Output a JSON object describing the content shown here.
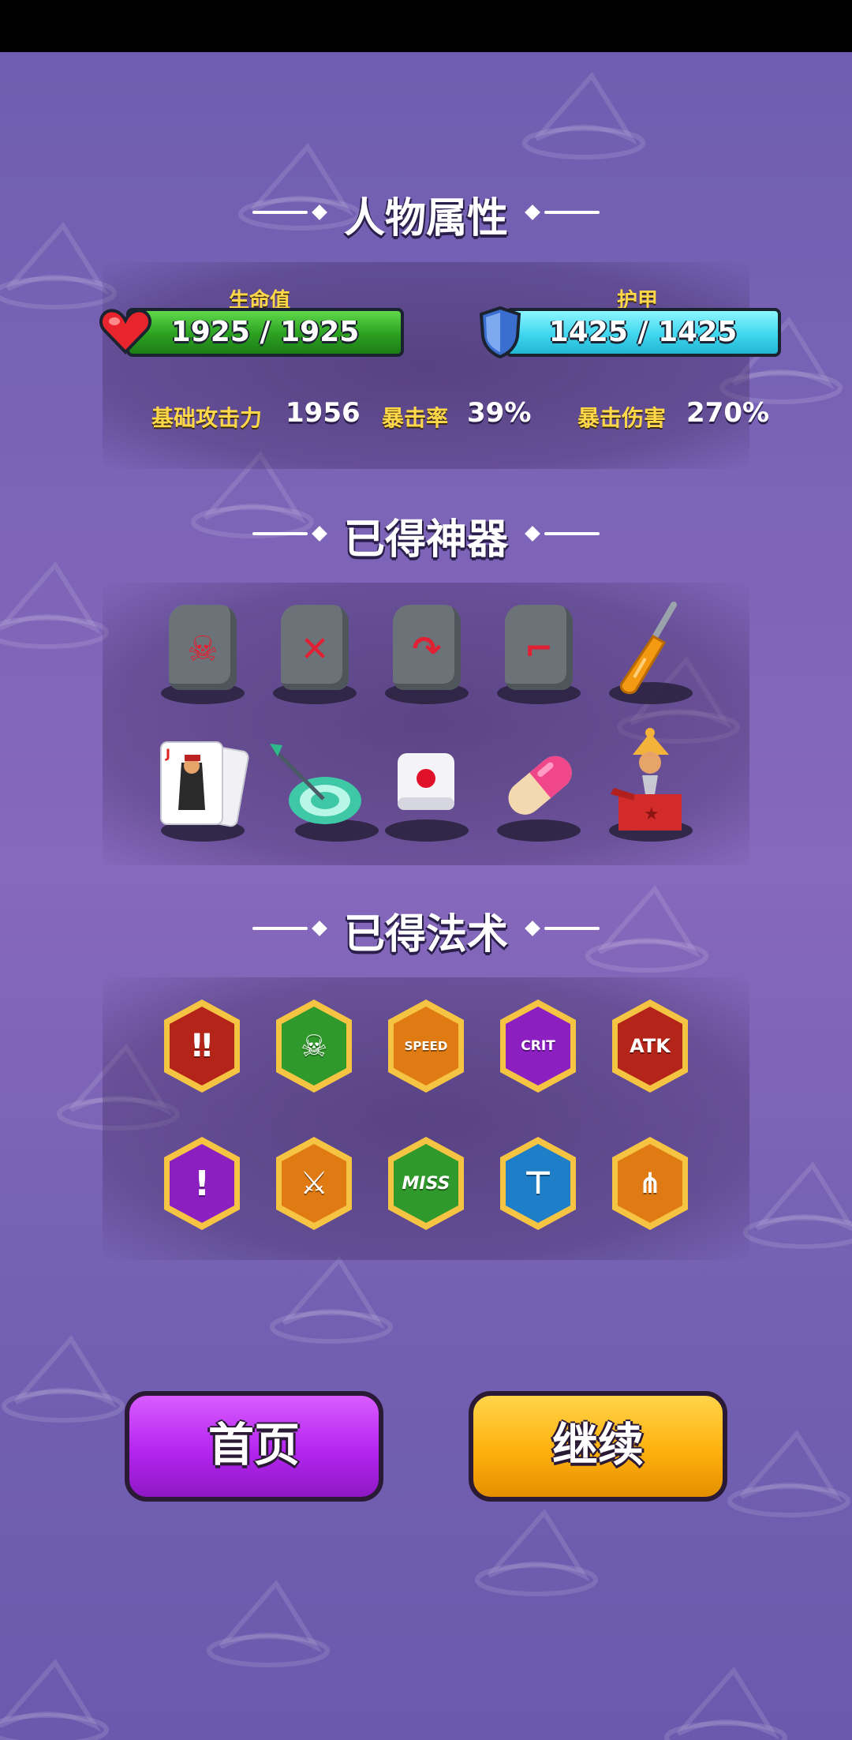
{
  "sections": {
    "attributes_title": "人物属性",
    "artifacts_title": "已得神器",
    "spells_title": "已得法术"
  },
  "stats": {
    "hp_label": "生命值",
    "hp_value": "1925 / 1925",
    "armor_label": "护甲",
    "armor_value": "1425 / 1425"
  },
  "attributes": {
    "base_attack_label": "基础攻击力",
    "base_attack_value": "1956",
    "crit_rate_label": "暴击率",
    "crit_rate_value": "39%",
    "crit_damage_label": "暴击伤害",
    "crit_damage_value": "270%"
  },
  "artifacts": [
    {
      "icon": "skull-tombstone-icon"
    },
    {
      "icon": "cross-arrows-tombstone-icon"
    },
    {
      "icon": "hook-tombstone-icon"
    },
    {
      "icon": "boot-tombstone-icon"
    },
    {
      "icon": "screwdriver-icon"
    },
    {
      "icon": "jack-card-icon"
    },
    {
      "icon": "dart-target-icon"
    },
    {
      "icon": "dice-icon"
    },
    {
      "icon": "pill-icon"
    },
    {
      "icon": "jack-in-the-box-icon"
    }
  ],
  "spells": [
    {
      "icon": "double-arrow-down-icon",
      "text": ""
    },
    {
      "icon": "skull-bounce-icon",
      "text": ""
    },
    {
      "icon": "speed-up-icon",
      "text": "SPEED"
    },
    {
      "icon": "crit-up-icon",
      "text": "CRIT"
    },
    {
      "icon": "atk-up-icon",
      "text": "ATK"
    },
    {
      "icon": "single-arrow-down-icon",
      "text": ""
    },
    {
      "icon": "crossed-swords-icon",
      "text": ""
    },
    {
      "icon": "miss-icon",
      "text": "MISS"
    },
    {
      "icon": "turret-icon",
      "text": ""
    },
    {
      "icon": "triple-arrow-icon",
      "text": ""
    }
  ],
  "buttons": {
    "home_label": "首页",
    "continue_label": "继续"
  },
  "colors": {
    "hp_bar": "#2ca021",
    "armor_bar": "#3fd6ef",
    "label_gold": "#ffd84a",
    "home_button": "#b425ef",
    "continue_button": "#ffb10e",
    "background": "#7a63b6"
  }
}
